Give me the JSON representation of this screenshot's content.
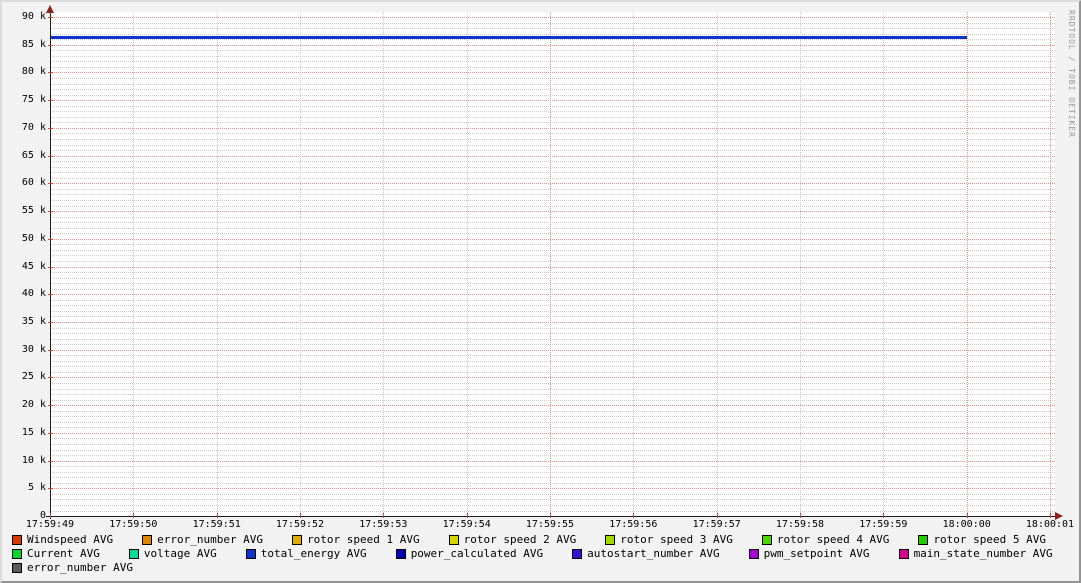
{
  "watermark": "RRDTOOL / TOBI OETIKER",
  "colors": {
    "background": "#f2f2f2",
    "canvas": "#ffffff",
    "axis": "#1c1c1c",
    "arrow": "#8b2020",
    "grid_minor": "#cbcbcb",
    "grid_major": "#e79090",
    "axis_tick": "#c04848",
    "border_light": "#dcdcdc",
    "border_dark": "#949494"
  },
  "chart_data": {
    "type": "line",
    "title": "",
    "xlabel": "",
    "ylabel": "",
    "grid": true,
    "legend_position": "bottom",
    "y_axis": {
      "min": 0,
      "max": 90000,
      "major_step": 5000,
      "minor_step": 1000,
      "tick_labels": [
        "0",
        "5 k",
        "10 k",
        "15 k",
        "20 k",
        "25 k",
        "30 k",
        "35 k",
        "40 k",
        "45 k",
        "50 k",
        "55 k",
        "60 k",
        "65 k",
        "70 k",
        "75 k",
        "80 k",
        "85 k",
        "90 k"
      ]
    },
    "x_ticks": [
      {
        "label": "17:59:49",
        "major": false
      },
      {
        "label": "17:59:50",
        "major": false
      },
      {
        "label": "17:59:51",
        "major": false
      },
      {
        "label": "17:59:52",
        "major": false
      },
      {
        "label": "17:59:53",
        "major": false
      },
      {
        "label": "17:59:54",
        "major": false
      },
      {
        "label": "17:59:55",
        "major": true
      },
      {
        "label": "17:59:56",
        "major": false
      },
      {
        "label": "17:59:57",
        "major": false
      },
      {
        "label": "17:59:58",
        "major": false
      },
      {
        "label": "17:59:59",
        "major": false
      },
      {
        "label": "18:00:00",
        "major": true
      },
      {
        "label": "18:00:01",
        "major": true
      }
    ],
    "series": [
      {
        "name": "total_energy AVG",
        "color": "#0d35cc",
        "shape": "flat-horizontal-line",
        "value": 86400,
        "x_start": "17:59:49",
        "x_end": "18:00:00"
      }
    ],
    "legend_rows": [
      [
        {
          "label": "Windspeed AVG",
          "color": "#d93a00"
        },
        {
          "label": "error_number AVG",
          "color": "#dd8400"
        },
        {
          "label": "rotor speed 1 AVG",
          "color": "#ddaf00"
        },
        {
          "label": "rotor speed 2 AVG",
          "color": "#d6d600"
        },
        {
          "label": "rotor speed 3 AVG",
          "color": "#a2d800"
        },
        {
          "label": "rotor speed 4 AVG",
          "color": "#4fd600"
        },
        {
          "label": "rotor speed 5 AVG",
          "color": "#1ecc00"
        }
      ],
      [
        {
          "label": "Current AVG",
          "color": "#00d62b"
        },
        {
          "label": "voltage AVG",
          "color": "#00dc9b"
        },
        {
          "label": "total_energy AVG",
          "color": "#0d35cc"
        },
        {
          "label": "power_calculated AVG",
          "color": "#0000b8"
        },
        {
          "label": "autostart_number AVG",
          "color": "#3711d4"
        },
        {
          "label": "pwm_setpoint AVG",
          "color": "#a600d6"
        },
        {
          "label": "main_state_number AVG",
          "color": "#d6008f"
        }
      ],
      [
        {
          "label": "error_number AVG",
          "color": "#5c5c5c"
        }
      ]
    ]
  }
}
